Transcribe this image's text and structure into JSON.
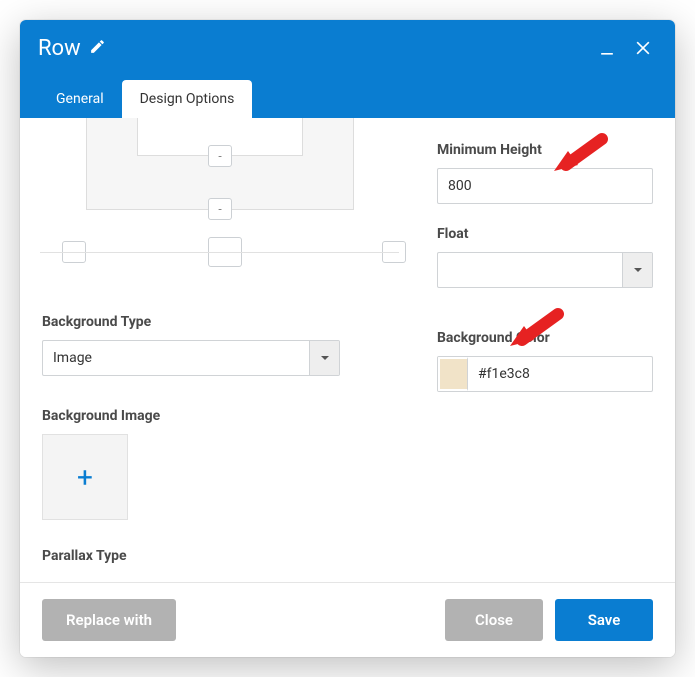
{
  "title": "Row",
  "tabs": {
    "general": "General",
    "design": "Design Options"
  },
  "left": {
    "bg_type_label": "Background Type",
    "bg_type_value": "Image",
    "bg_image_label": "Background Image",
    "parallax_label": "Parallax Type",
    "spacer_dash": "-"
  },
  "right": {
    "min_h_label": "Minimum Height",
    "min_h_value": "800",
    "float_label": "Float",
    "float_value": "",
    "bg_color_label": "Background Color",
    "bg_color_value": "#f1e3c8"
  },
  "footer": {
    "replace": "Replace with",
    "close": "Close",
    "save": "Save"
  },
  "colors": {
    "swatch": "#f1e3c8"
  }
}
